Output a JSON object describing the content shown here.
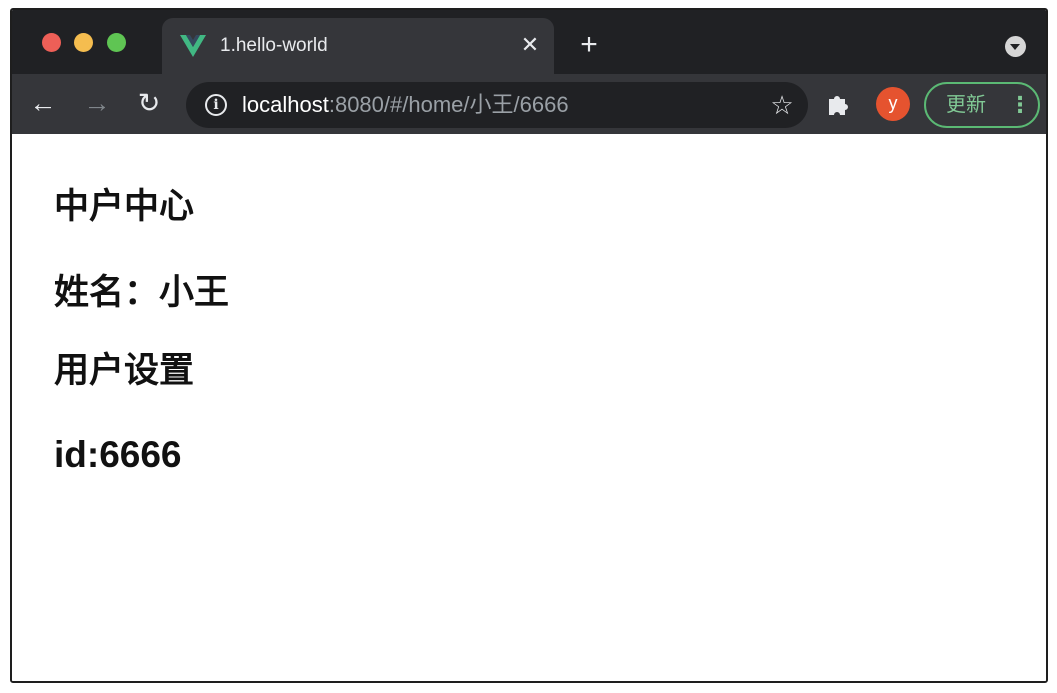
{
  "window": {
    "traffic_lights": [
      "close",
      "minimize",
      "zoom"
    ]
  },
  "tab": {
    "title": "1.hello-world",
    "favicon": "vue-logo-icon",
    "close_glyph": "✕"
  },
  "tabstrip": {
    "new_tab_glyph": "+",
    "menu_icon": "chevron-down-icon"
  },
  "toolbar": {
    "back_glyph": "←",
    "forward_glyph": "→",
    "reload_glyph": "↻",
    "url_host": "localhost",
    "url_rest": ":8080/#/home/小王/6666",
    "bookmark_glyph": "☆",
    "avatar_letter": "y",
    "update_label": "更新",
    "more_glyph": "⋮"
  },
  "page": {
    "center_heading": "中户中心",
    "name_line": "姓名：小王",
    "settings_heading": "用户设置",
    "id_line": "id:6666"
  },
  "colors": {
    "tabstrip_bg": "#202124",
    "toolbar_bg": "#35363a",
    "vue_green": "#41b883",
    "avatar_bg": "#e5532f",
    "update_green": "#5bb974"
  }
}
